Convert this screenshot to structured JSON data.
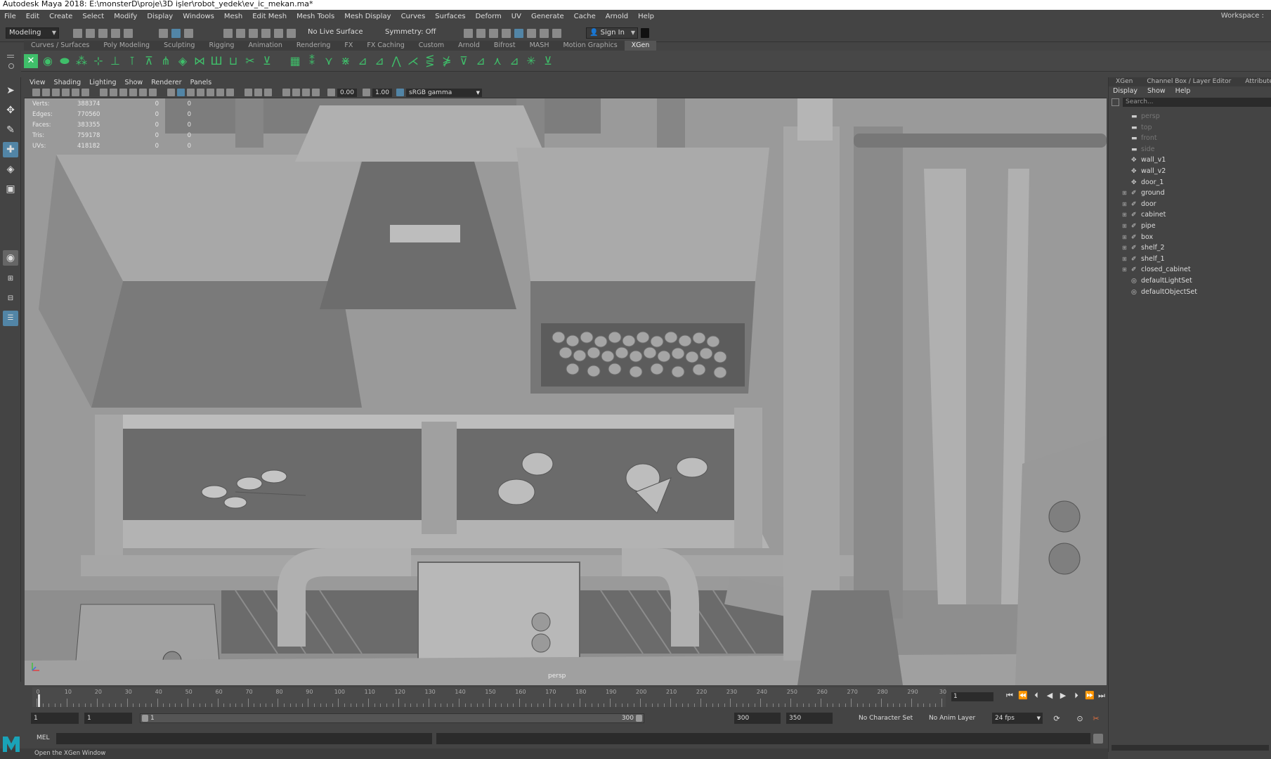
{
  "window": {
    "title": "Autodesk Maya 2018: E:\\monsterD\\proje\\3D işler\\robot_yedek\\ev_ic_mekan.ma*"
  },
  "menubar": {
    "items": [
      "File",
      "Edit",
      "Create",
      "Select",
      "Modify",
      "Display",
      "Windows",
      "Mesh",
      "Edit Mesh",
      "Mesh Tools",
      "Mesh Display",
      "Curves",
      "Surfaces",
      "Deform",
      "UV",
      "Generate",
      "Cache",
      "Arnold",
      "Help"
    ],
    "workspace_label": "Workspace :"
  },
  "statusline": {
    "mode": "Modeling",
    "live_surface": "No Live Surface",
    "symmetry": "Symmetry: Off",
    "signin": "Sign In"
  },
  "shelf": {
    "tabs": [
      "Curves / Surfaces",
      "Poly Modeling",
      "Sculpting",
      "Rigging",
      "Animation",
      "Rendering",
      "FX",
      "FX Caching",
      "Custom",
      "Arnold",
      "Bifrost",
      "MASH",
      "Motion Graphics",
      "XGen"
    ],
    "active_tab": "XGen"
  },
  "panel": {
    "menu": [
      "View",
      "Shading",
      "Lighting",
      "Show",
      "Renderer",
      "Panels"
    ],
    "exposure": "0.00",
    "gamma": "1.00",
    "colorspace": "sRGB gamma",
    "camera_label": "persp"
  },
  "hud": {
    "rows": [
      {
        "label": "Verts:",
        "a": "388374",
        "b": "0",
        "c": "0"
      },
      {
        "label": "Edges:",
        "a": "770560",
        "b": "0",
        "c": "0"
      },
      {
        "label": "Faces:",
        "a": "383355",
        "b": "0",
        "c": "0"
      },
      {
        "label": "Tris:",
        "a": "759178",
        "b": "0",
        "c": "0"
      },
      {
        "label": "UVs:",
        "a": "418182",
        "b": "0",
        "c": "0"
      }
    ]
  },
  "outliner": {
    "tabs": [
      "XGen",
      "Channel Box / Layer Editor",
      "Attribute Ed"
    ],
    "menu": [
      "Display",
      "Show",
      "Help"
    ],
    "search_placeholder": "Search...",
    "items": [
      {
        "name": "persp",
        "type": "camera",
        "dim": true,
        "expandable": false
      },
      {
        "name": "top",
        "type": "camera",
        "dim": true,
        "expandable": false
      },
      {
        "name": "front",
        "type": "camera",
        "dim": true,
        "expandable": false
      },
      {
        "name": "side",
        "type": "camera",
        "dim": true,
        "expandable": false
      },
      {
        "name": "wall_v1",
        "type": "mesh",
        "dim": false,
        "expandable": false
      },
      {
        "name": "wall_v2",
        "type": "mesh",
        "dim": false,
        "expandable": false
      },
      {
        "name": "door_1",
        "type": "mesh",
        "dim": false,
        "expandable": false
      },
      {
        "name": "ground",
        "type": "group",
        "dim": false,
        "expandable": true
      },
      {
        "name": "door",
        "type": "group",
        "dim": false,
        "expandable": true
      },
      {
        "name": "cabinet",
        "type": "group",
        "dim": false,
        "expandable": true
      },
      {
        "name": "pipe",
        "type": "group",
        "dim": false,
        "expandable": true
      },
      {
        "name": "box",
        "type": "group",
        "dim": false,
        "expandable": true
      },
      {
        "name": "shelf_2",
        "type": "group",
        "dim": false,
        "expandable": true
      },
      {
        "name": "shelf_1",
        "type": "group",
        "dim": false,
        "expandable": true
      },
      {
        "name": "closed_cabinet",
        "type": "group",
        "dim": false,
        "expandable": true
      },
      {
        "name": "defaultLightSet",
        "type": "set",
        "dim": false,
        "expandable": false
      },
      {
        "name": "defaultObjectSet",
        "type": "set",
        "dim": false,
        "expandable": false
      }
    ]
  },
  "timeline": {
    "ticks": [
      "0",
      "10",
      "20",
      "30",
      "40",
      "50",
      "60",
      "70",
      "80",
      "90",
      "100",
      "110",
      "120",
      "130",
      "140",
      "150",
      "160",
      "170",
      "180",
      "190",
      "200",
      "210",
      "220",
      "230",
      "240",
      "250",
      "260",
      "270",
      "280",
      "290",
      "30"
    ],
    "current_frame": "1"
  },
  "range": {
    "start": "1",
    "playback_start": "1",
    "slider_start": "1",
    "slider_end": "300",
    "playback_end": "300",
    "end": "350",
    "character_set": "No Character Set",
    "anim_layer": "No Anim Layer",
    "fps": "24 fps"
  },
  "cmdline": {
    "language": "MEL"
  },
  "helpline": {
    "text": "Open the XGen Window"
  },
  "colors": {
    "accent": "#5285a6",
    "shelf_green": "#3fbf6a",
    "viewport_bg": "#8f8f8f"
  }
}
